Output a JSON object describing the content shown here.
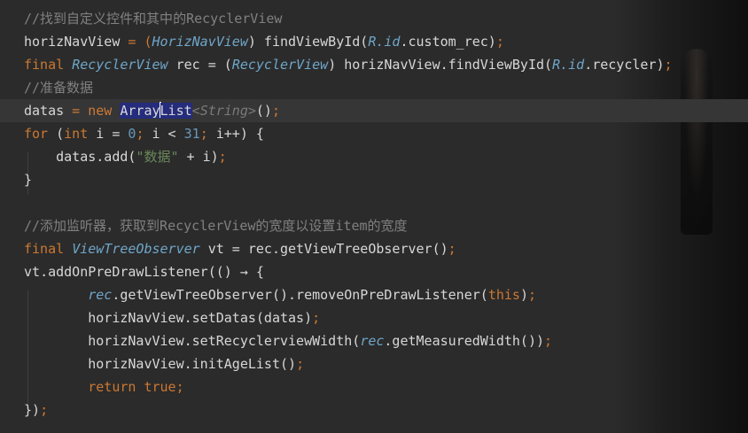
{
  "code": {
    "l1": {
      "comment": "//找到自定义控件和其中的RecyclerView"
    },
    "l2": {
      "a": "horizNavView",
      "b": " = (",
      "c": "HorizNavView",
      "d": ") findViewById(",
      "e": "R.id",
      "f": ".custom_rec)",
      "g": ";"
    },
    "l3": {
      "a": "final ",
      "b": "RecyclerView",
      "c": " rec = (",
      "d": "RecyclerView",
      "e": ") horizNavView",
      "f": ".findViewById(",
      "g": "R.id",
      "h": ".recycler)",
      "i": ";"
    },
    "l4": {
      "comment": "//准备数据"
    },
    "l5": {
      "a": "datas",
      "b": " = ",
      "c": "new ",
      "d1": "Array",
      "d2": "List",
      "e": "<",
      "f": "String",
      "g": ">",
      "h": "()",
      "i": ";"
    },
    "l6": {
      "a": "for ",
      "b": "(",
      "c": "int",
      "d": " i = ",
      "e": "0",
      "f": "; ",
      "g": "i < ",
      "h": "31",
      "i": "; ",
      "j": "i++) {"
    },
    "l7": {
      "a": "    datas",
      "b": ".add(",
      "c": "\"数据\"",
      "d": " + i)",
      "e": ";"
    },
    "l8": {
      "a": "}"
    },
    "l9": {
      "a": ""
    },
    "l10": {
      "comment": "//添加监听器，获取到RecyclerView的宽度以设置item的宽度"
    },
    "l11": {
      "a": "final ",
      "b": "ViewTreeObserver",
      "c": " vt = rec",
      "d": ".getViewTreeObserver()",
      "e": ";"
    },
    "l12": {
      "a": "vt",
      "b": ".addOnPreDrawListener(() → {"
    },
    "l13": {
      "a": "        ",
      "b": "rec",
      "c": ".getViewTreeObserver()",
      "d": ".removeOnPreDrawListener(",
      "e": "this",
      "f": ")",
      "g": ";"
    },
    "l14": {
      "a": "        horizNavView",
      "b": ".setDatas(datas)",
      "c": ";"
    },
    "l15": {
      "a": "        horizNavView",
      "b": ".setRecyclerviewWidth(",
      "c": "rec",
      "d": ".getMeasuredWidth())",
      "e": ";"
    },
    "l16": {
      "a": "        horizNavView",
      "b": ".initAgeList()",
      "c": ";"
    },
    "l17": {
      "a": "        ",
      "b": "return true",
      "c": ";"
    },
    "l18": {
      "a": "})",
      "b": ";"
    }
  },
  "colors": {
    "background": "#2b2b2b",
    "comment": "#808080",
    "keyword": "#cc7832",
    "type_italic": "#6fa6c9",
    "number": "#6897bb",
    "string": "#6a8759",
    "selection": "#21287a"
  }
}
